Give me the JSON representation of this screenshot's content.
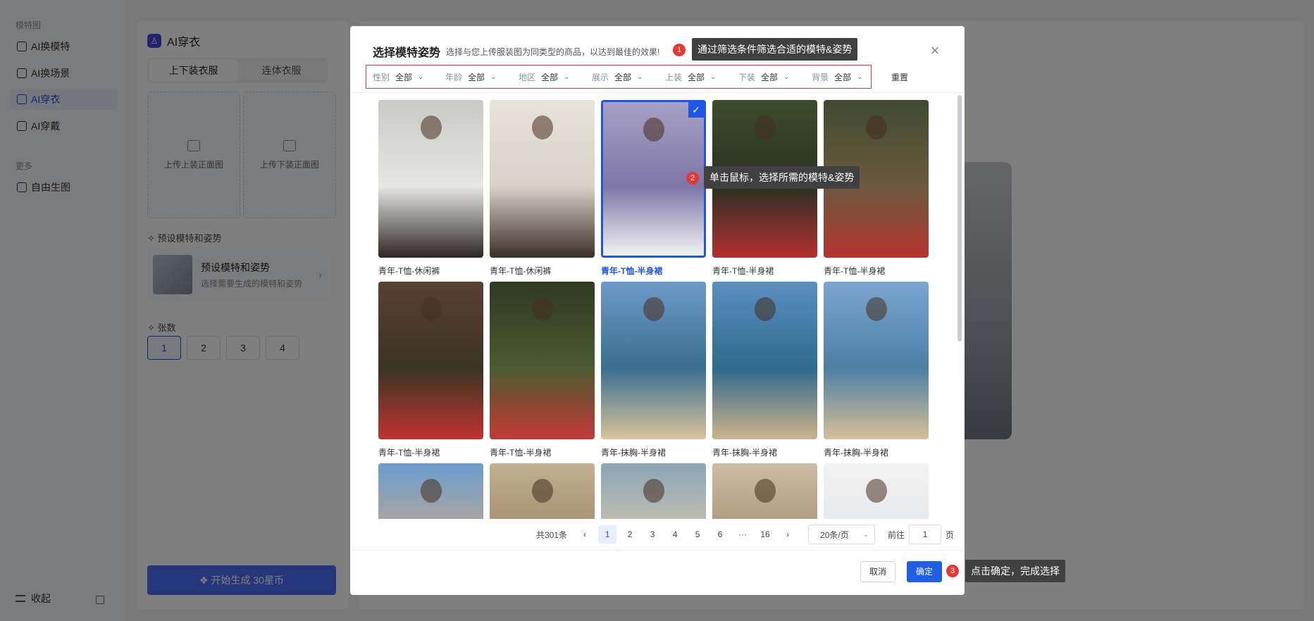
{
  "sidebar": {
    "section1": "模特图",
    "items": [
      {
        "label": "AI换模特",
        "icon": "user-icon"
      },
      {
        "label": "AI换场景",
        "icon": "image-icon"
      },
      {
        "label": "AI穿衣",
        "icon": "shirt-icon",
        "active": true
      },
      {
        "label": "AI穿戴",
        "icon": "watch-icon"
      }
    ],
    "section2": "更多",
    "items2": [
      {
        "label": "自由生图",
        "icon": "palette-icon"
      }
    ],
    "collapse_label": "收起"
  },
  "panel": {
    "title": "AI穿衣",
    "tabs": [
      "上下装衣服",
      "连体衣服"
    ],
    "upload_top": "上传上装正面图",
    "upload_bottom": "上传下装正面图",
    "preset_section": "✧ 预设模特和姿势",
    "preset_title": "预设模特和姿势",
    "preset_desc": "选择需要生成的模特和姿势",
    "count_section": "✧ 张数",
    "counts": [
      "1",
      "2",
      "3",
      "4"
    ],
    "generate_label": "❖ 开始生成 30星币"
  },
  "modal": {
    "title": "选择模特姿势",
    "subtitle": "选择与您上传服装图为同类型的商品，以达到最佳的效果!",
    "filters": [
      {
        "key": "性别",
        "value": "全部"
      },
      {
        "key": "年龄",
        "value": "全部"
      },
      {
        "key": "地区",
        "value": "全部"
      },
      {
        "key": "展示",
        "value": "全部"
      },
      {
        "key": "上装",
        "value": "全部"
      },
      {
        "key": "下装",
        "value": "全部"
      },
      {
        "key": "背景",
        "value": "全部"
      }
    ],
    "reset": "重置",
    "cards": [
      {
        "caption": "青年-T恤-休闲裤",
        "colors": [
          "#c9c9c6",
          "#e6e6e3",
          "#2c2624"
        ],
        "selected": false
      },
      {
        "caption": "青年-T恤-休闲裤",
        "colors": [
          "#e8e4dc",
          "#d7d1c6",
          "#3b2e28"
        ],
        "selected": false
      },
      {
        "caption": "青年-T恤-半身裙",
        "colors": [
          "#a7a0c4",
          "#7d76a8",
          "#f2f2f2"
        ],
        "selected": true
      },
      {
        "caption": "青年-T恤-半身裙",
        "colors": [
          "#3d4c2a",
          "#2b2f24",
          "#b3302f"
        ],
        "selected": false
      },
      {
        "caption": "青年-T恤-半身裙",
        "colors": [
          "#3f4a30",
          "#6b5a3f",
          "#b5332e"
        ],
        "selected": false
      },
      {
        "caption": "青年-T恤-半身裙",
        "colors": [
          "#5a4030",
          "#3a3424",
          "#c0332f"
        ],
        "selected": false
      },
      {
        "caption": "青年-T恤-半身裙",
        "colors": [
          "#2e3a22",
          "#4b5a30",
          "#c43a35"
        ],
        "selected": false
      },
      {
        "caption": "青年-抹胸-半身裙",
        "colors": [
          "#6d9ac9",
          "#3b6e8f",
          "#d9c39d"
        ],
        "selected": false
      },
      {
        "caption": "青年-抹胸-半身裙",
        "colors": [
          "#5b8fc0",
          "#2f6a8d",
          "#cdb28c"
        ],
        "selected": false
      },
      {
        "caption": "青年-抹胸-半身裙",
        "colors": [
          "#7ba6cf",
          "#4c7fa3",
          "#d7bf98"
        ],
        "selected": false
      },
      {
        "caption": "",
        "colors": [
          "#6a9dd0",
          "#c8a889",
          "#b98e6e"
        ],
        "selected": false
      },
      {
        "caption": "",
        "colors": [
          "#c2b091",
          "#9c8566",
          "#3c2c22"
        ],
        "selected": false
      },
      {
        "caption": "",
        "colors": [
          "#8aa6b7",
          "#d9c7b0",
          "#2b2522"
        ],
        "selected": false
      },
      {
        "caption": "",
        "colors": [
          "#cdbda4",
          "#a48c6d",
          "#2e2420"
        ],
        "selected": false
      },
      {
        "caption": "",
        "colors": [
          "#f2f2f2",
          "#e1e4e7",
          "#8aa27c"
        ],
        "selected": false
      }
    ],
    "pagination": {
      "total": "共301条",
      "pages": [
        "1",
        "2",
        "3",
        "4",
        "5",
        "6",
        "···",
        "16"
      ],
      "current": "1",
      "page_size": "20条/页",
      "goto_label": "前往",
      "goto_value": "1",
      "goto_suffix": "页"
    },
    "cancel_label": "取消",
    "ok_label": "确定"
  },
  "tips": [
    {
      "num": "1",
      "text": "通过筛选条件筛选合适的模特&姿势"
    },
    {
      "num": "2",
      "text": "单击鼠标，选择所需的模特&姿势"
    },
    {
      "num": "3",
      "text": "点击确定，完成选择"
    }
  ],
  "colors": {
    "accent": "#1f56e6",
    "highlight": "#e53935"
  }
}
